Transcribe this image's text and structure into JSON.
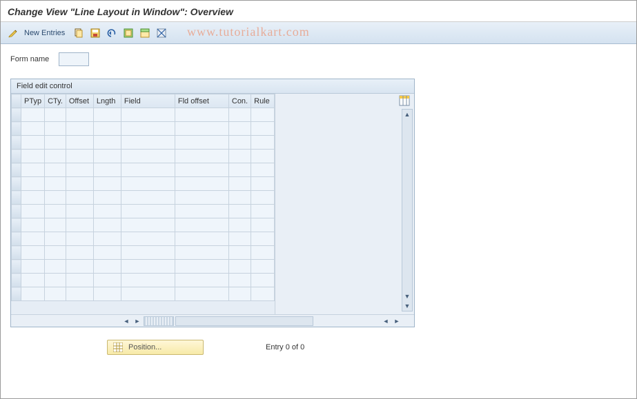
{
  "title": "Change View \"Line Layout in Window\": Overview",
  "toolbar": {
    "new_entries": "New Entries"
  },
  "watermark": "www.tutorialkart.com",
  "form": {
    "name_label": "Form name",
    "name_value": ""
  },
  "panel": {
    "title": "Field edit control",
    "columns": {
      "ptyp": "PTyp",
      "cty": "CTy.",
      "offset": "Offset",
      "length": "Lngth",
      "field": "Field",
      "fldo": "Fld offset",
      "con": "Con.",
      "rule": "Rule"
    },
    "rows": [
      {
        "ptyp": "",
        "cty": "",
        "offset": "",
        "length": "",
        "field": "",
        "fldo": "",
        "con": "",
        "rule": ""
      },
      {
        "ptyp": "",
        "cty": "",
        "offset": "",
        "length": "",
        "field": "",
        "fldo": "",
        "con": "",
        "rule": ""
      },
      {
        "ptyp": "",
        "cty": "",
        "offset": "",
        "length": "",
        "field": "",
        "fldo": "",
        "con": "",
        "rule": ""
      },
      {
        "ptyp": "",
        "cty": "",
        "offset": "",
        "length": "",
        "field": "",
        "fldo": "",
        "con": "",
        "rule": ""
      },
      {
        "ptyp": "",
        "cty": "",
        "offset": "",
        "length": "",
        "field": "",
        "fldo": "",
        "con": "",
        "rule": ""
      },
      {
        "ptyp": "",
        "cty": "",
        "offset": "",
        "length": "",
        "field": "",
        "fldo": "",
        "con": "",
        "rule": ""
      },
      {
        "ptyp": "",
        "cty": "",
        "offset": "",
        "length": "",
        "field": "",
        "fldo": "",
        "con": "",
        "rule": ""
      },
      {
        "ptyp": "",
        "cty": "",
        "offset": "",
        "length": "",
        "field": "",
        "fldo": "",
        "con": "",
        "rule": ""
      },
      {
        "ptyp": "",
        "cty": "",
        "offset": "",
        "length": "",
        "field": "",
        "fldo": "",
        "con": "",
        "rule": ""
      },
      {
        "ptyp": "",
        "cty": "",
        "offset": "",
        "length": "",
        "field": "",
        "fldo": "",
        "con": "",
        "rule": ""
      },
      {
        "ptyp": "",
        "cty": "",
        "offset": "",
        "length": "",
        "field": "",
        "fldo": "",
        "con": "",
        "rule": ""
      },
      {
        "ptyp": "",
        "cty": "",
        "offset": "",
        "length": "",
        "field": "",
        "fldo": "",
        "con": "",
        "rule": ""
      },
      {
        "ptyp": "",
        "cty": "",
        "offset": "",
        "length": "",
        "field": "",
        "fldo": "",
        "con": "",
        "rule": ""
      },
      {
        "ptyp": "",
        "cty": "",
        "offset": "",
        "length": "",
        "field": "",
        "fldo": "",
        "con": "",
        "rule": ""
      }
    ]
  },
  "footer": {
    "position_label": "Position...",
    "entry_text": "Entry 0 of 0"
  },
  "icons": {
    "pencil": "pencil-icon",
    "copy": "copy-icon",
    "save": "save-icon",
    "undo": "undo-icon",
    "select_all": "select-all-icon",
    "select_block": "select-block-icon",
    "deselect": "deselect-icon",
    "config": "table-settings-icon",
    "grid": "grid-icon"
  }
}
